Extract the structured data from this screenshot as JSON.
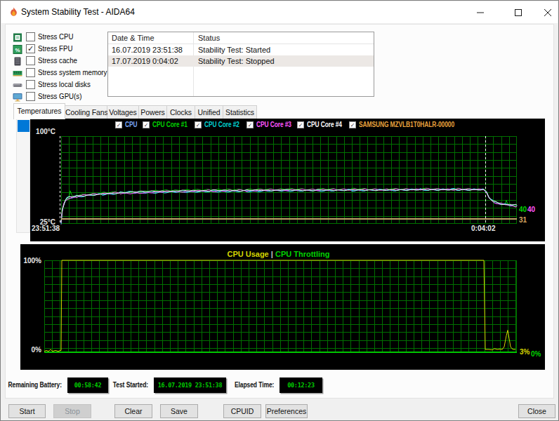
{
  "window": {
    "title": "System Stability Test - AIDA64",
    "minimize_glyph": "–",
    "maximize_glyph": "▢",
    "close_glyph": "✕"
  },
  "stress_options": [
    {
      "label": "Stress CPU",
      "checked": false,
      "icon": "cpu-icon"
    },
    {
      "label": "Stress FPU",
      "checked": true,
      "icon": "fpu-icon"
    },
    {
      "label": "Stress cache",
      "checked": false,
      "icon": "cache-icon"
    },
    {
      "label": "Stress system memory",
      "checked": false,
      "icon": "memory-icon"
    },
    {
      "label": "Stress local disks",
      "checked": false,
      "icon": "disk-icon"
    },
    {
      "label": "Stress GPU(s)",
      "checked": false,
      "icon": "gpu-icon"
    }
  ],
  "log": {
    "columns": [
      "Date & Time",
      "Status"
    ],
    "rows": [
      {
        "datetime": "16.07.2019 23:51:38",
        "status": "Stability Test: Started",
        "highlight": false
      },
      {
        "datetime": "17.07.2019 0:04:02",
        "status": "Stability Test: Stopped",
        "highlight": true
      }
    ]
  },
  "tabs": [
    {
      "label": "Temperatures",
      "active": true
    },
    {
      "label": "Cooling Fans",
      "active": false
    },
    {
      "label": "Voltages",
      "active": false
    },
    {
      "label": "Powers",
      "active": false
    },
    {
      "label": "Clocks",
      "active": false
    },
    {
      "label": "Unified",
      "active": false
    },
    {
      "label": "Statistics",
      "active": false
    }
  ],
  "chart_data": [
    {
      "type": "line",
      "id": "temperature",
      "ylim": [
        25,
        100
      ],
      "y_top_label": "100°C",
      "y_bottom_label": "25°C",
      "x_start_label": "23:51:38",
      "x_end_label": "0:04:02",
      "legend": [
        {
          "label": "CPU",
          "color": "#7aa8f8",
          "checked": true
        },
        {
          "label": "CPU Core #1",
          "color": "#00d200",
          "checked": true
        },
        {
          "label": "CPU Core #2",
          "color": "#00d2d2",
          "checked": true
        },
        {
          "label": "CPU Core #3",
          "color": "#ff55ff",
          "checked": true
        },
        {
          "label": "CPU Core #4",
          "color": "#ffffff",
          "checked": true
        },
        {
          "label": "SAMSUNG MZVLB1T0HALR-00000",
          "color": "#e8a33d",
          "checked": true
        }
      ],
      "series": [
        {
          "name": "CPU",
          "color": "#6f9fe8",
          "offset": 1.0,
          "jitter": 1.1,
          "anchors": [
            [
              86,
              26
            ],
            [
              87,
              33
            ],
            [
              88,
              38
            ],
            [
              90,
              42
            ],
            [
              92,
              45
            ],
            [
              94,
              46.5
            ],
            [
              97,
              47.5
            ],
            [
              103,
              48.2
            ],
            [
              110,
              48.8
            ],
            [
              125,
              49.8
            ],
            [
              145,
              50.8
            ],
            [
              170,
              51.6
            ],
            [
              200,
              52.2
            ],
            [
              250,
              53
            ],
            [
              300,
              53.4
            ],
            [
              350,
              53.6
            ],
            [
              400,
              54
            ],
            [
              450,
              54
            ],
            [
              500,
              54.2
            ],
            [
              550,
              54.2
            ],
            [
              600,
              54.5
            ],
            [
              650,
              54.5
            ],
            [
              688,
              54.5
            ],
            [
              692,
              52
            ],
            [
              695,
              48
            ],
            [
              698,
              46
            ],
            [
              702,
              44
            ],
            [
              707,
              43
            ],
            [
              712,
              42.3
            ],
            [
              718,
              41.8
            ],
            [
              725,
              41.3
            ],
            [
              735,
              40.5
            ]
          ]
        },
        {
          "name": "CPU Core #1",
          "color": "#00c800",
          "offset": -0.5,
          "jitter": 1.2,
          "anchors": [
            [
              86,
              26
            ],
            [
              87,
              33
            ],
            [
              88,
              38
            ],
            [
              90,
              42
            ],
            [
              92,
              45
            ],
            [
              94,
              46.5
            ],
            [
              97,
              47.5
            ],
            [
              99,
              53
            ],
            [
              101,
              48.5
            ],
            [
              103,
              48.2
            ],
            [
              110,
              48.8
            ],
            [
              125,
              49.8
            ],
            [
              145,
              50.8
            ],
            [
              170,
              51.6
            ],
            [
              200,
              52.2
            ],
            [
              250,
              53
            ],
            [
              300,
              53.4
            ],
            [
              350,
              53.6
            ],
            [
              400,
              54
            ],
            [
              450,
              54
            ],
            [
              500,
              54.2
            ],
            [
              550,
              54.2
            ],
            [
              600,
              54.5
            ],
            [
              650,
              54.5
            ],
            [
              688,
              54.5
            ],
            [
              692,
              52
            ],
            [
              695,
              48
            ],
            [
              698,
              46
            ],
            [
              702,
              44
            ],
            [
              707,
              43
            ],
            [
              712,
              42.3
            ],
            [
              718,
              41.8
            ],
            [
              720,
              44.5
            ],
            [
              722,
              41.5
            ],
            [
              725,
              41.3
            ],
            [
              735,
              40
            ]
          ]
        },
        {
          "name": "CPU Core #2",
          "color": "#00c8c8",
          "offset": 0,
          "jitter": 1.3,
          "anchors": [
            [
              86,
              26
            ],
            [
              87,
              33
            ],
            [
              88,
              38
            ],
            [
              90,
              42
            ],
            [
              92,
              45
            ],
            [
              94,
              46.5
            ],
            [
              97,
              47.5
            ],
            [
              103,
              48.2
            ],
            [
              110,
              48.8
            ],
            [
              125,
              49.8
            ],
            [
              145,
              50.8
            ],
            [
              170,
              51.6
            ],
            [
              200,
              52.2
            ],
            [
              250,
              53
            ],
            [
              300,
              53.4
            ],
            [
              350,
              53.6
            ],
            [
              400,
              54
            ],
            [
              450,
              54
            ],
            [
              500,
              54.2
            ],
            [
              550,
              54.2
            ],
            [
              600,
              54.5
            ],
            [
              650,
              54.5
            ],
            [
              688,
              54.5
            ],
            [
              692,
              52
            ],
            [
              695,
              48
            ],
            [
              698,
              46
            ],
            [
              702,
              44
            ],
            [
              707,
              43
            ],
            [
              712,
              42.3
            ],
            [
              718,
              41.8
            ],
            [
              725,
              41.3
            ],
            [
              735,
              40.5
            ]
          ]
        },
        {
          "name": "CPU Core #3",
          "color": "#ff50ff",
          "offset": 0.5,
          "jitter": 1.2,
          "anchors": [
            [
              86,
              26
            ],
            [
              87,
              33
            ],
            [
              88,
              38
            ],
            [
              90,
              42
            ],
            [
              92,
              45
            ],
            [
              94,
              46.5
            ],
            [
              97,
              47.5
            ],
            [
              103,
              48.2
            ],
            [
              110,
              48.8
            ],
            [
              125,
              49.8
            ],
            [
              145,
              50.8
            ],
            [
              170,
              51.6
            ],
            [
              200,
              52.2
            ],
            [
              250,
              53
            ],
            [
              300,
              53.4
            ],
            [
              350,
              53.6
            ],
            [
              400,
              54
            ],
            [
              450,
              54
            ],
            [
              500,
              54.2
            ],
            [
              550,
              54.2
            ],
            [
              600,
              54.5
            ],
            [
              650,
              54.5
            ],
            [
              688,
              54.5
            ],
            [
              692,
              52
            ],
            [
              695,
              48
            ],
            [
              698,
              46
            ],
            [
              702,
              44
            ],
            [
              707,
              43
            ],
            [
              712,
              42.3
            ],
            [
              718,
              41.8
            ],
            [
              725,
              41.3
            ],
            [
              735,
              40.5
            ]
          ]
        },
        {
          "name": "CPU Core #4",
          "color": "#e8e8e8",
          "offset": 0,
          "jitter": 1.0,
          "anchors": [
            [
              86,
              26
            ],
            [
              87,
              33
            ],
            [
              88,
              38
            ],
            [
              90,
              42
            ],
            [
              92,
              45
            ],
            [
              94,
              46.5
            ],
            [
              97,
              47.5
            ],
            [
              103,
              48.2
            ],
            [
              110,
              48.8
            ],
            [
              125,
              49.8
            ],
            [
              145,
              50.8
            ],
            [
              170,
              51.6
            ],
            [
              200,
              52.2
            ],
            [
              250,
              53
            ],
            [
              300,
              53.4
            ],
            [
              350,
              53.6
            ],
            [
              400,
              54
            ],
            [
              450,
              54
            ],
            [
              500,
              54.2
            ],
            [
              550,
              54.2
            ],
            [
              600,
              54.5
            ],
            [
              650,
              54.5
            ],
            [
              688,
              54.5
            ],
            [
              692,
              52
            ],
            [
              695,
              48
            ],
            [
              698,
              46
            ],
            [
              702,
              44
            ],
            [
              707,
              43
            ],
            [
              712,
              42.3
            ],
            [
              718,
              41.8
            ],
            [
              725,
              41.3
            ],
            [
              735,
              40.8
            ]
          ]
        },
        {
          "name": "SAMSUNG MZVLB1T0HALR-00000",
          "color": "#c2a26a",
          "offset": 3,
          "jitter": 0,
          "width": 2,
          "anchors": [
            [
              86,
              31
            ],
            [
              735,
              31
            ]
          ]
        }
      ],
      "end_labels": [
        {
          "text": "40",
          "color": "#00d200",
          "x": 738,
          "y": 297
        },
        {
          "text": "40",
          "color": "#ff55ff",
          "x": 750,
          "y": 297
        },
        {
          "text": "31",
          "color": "#d8a860",
          "x": 738,
          "y": 312
        }
      ],
      "markers": [
        84,
        690
      ]
    },
    {
      "type": "line",
      "id": "cpu-usage",
      "ylim": [
        0,
        100
      ],
      "title_left": "CPU Usage",
      "title_sep": "|",
      "title_right": "CPU Throttling",
      "title_left_color": "#d6d600",
      "title_right_color": "#00d200",
      "y_top_label": "100%",
      "y_bottom_label": "0%",
      "series": [
        {
          "name": "CPU Usage",
          "color": "#d4d400",
          "offset": 0,
          "jitter": 0,
          "anchors": [
            [
              62,
              1
            ],
            [
              65,
              2
            ],
            [
              68,
              1
            ],
            [
              71,
              3
            ],
            [
              74,
              1
            ],
            [
              78,
              2
            ],
            [
              82,
              1
            ],
            [
              85,
              2
            ],
            [
              86,
              2
            ],
            [
              87,
              100
            ],
            [
              688,
              100
            ],
            [
              690,
              3
            ],
            [
              695,
              3
            ],
            [
              700,
              2.5
            ],
            [
              703,
              4
            ],
            [
              707,
              3
            ],
            [
              711,
              3.5
            ],
            [
              714,
              3
            ],
            [
              717,
              6
            ],
            [
              720,
              18
            ],
            [
              722,
              24
            ],
            [
              724,
              15
            ],
            [
              726,
              6
            ],
            [
              728,
              4
            ],
            [
              730,
              3
            ],
            [
              733,
              3
            ]
          ]
        },
        {
          "name": "CPU Throttling",
          "color": "#00c700",
          "offset": 0,
          "jitter": 0,
          "width": 2,
          "anchors": [
            [
              62,
              0
            ],
            [
              735,
              0
            ]
          ]
        }
      ],
      "end_labels": [
        {
          "text": "3%",
          "color": "#d6d600",
          "x": 739,
          "y": 500
        },
        {
          "text": "0%",
          "color": "#00d200",
          "x": 755,
          "y": 503
        }
      ]
    }
  ],
  "status_bar": {
    "battery_label": "Remaining Battery:",
    "battery_value": "00:58:42",
    "started_label": "Test Started:",
    "started_value": "16.07.2019 23:51:38",
    "elapsed_label": "Elapsed Time:",
    "elapsed_value": "00:12:23"
  },
  "buttons": [
    {
      "label": "Start",
      "x": 11,
      "w": 53,
      "enabled": true
    },
    {
      "label": "Stop",
      "x": 75,
      "w": 54,
      "enabled": false
    },
    {
      "label": "Clear",
      "x": 162,
      "w": 54,
      "enabled": true
    },
    {
      "label": "Save",
      "x": 227,
      "w": 54,
      "enabled": true
    },
    {
      "label": "CPUID",
      "x": 317,
      "w": 54,
      "enabled": true
    },
    {
      "label": "Preferences",
      "x": 377,
      "w": 60,
      "enabled": true
    },
    {
      "label": "Close",
      "x": 737,
      "w": 53,
      "enabled": true
    }
  ]
}
